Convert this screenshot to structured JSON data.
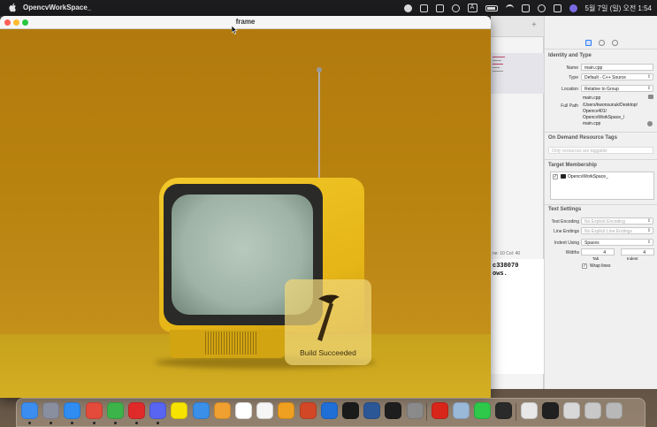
{
  "menubar": {
    "app_name": "OpencvWorkSpace_",
    "status_A": "A",
    "clock": "5월 7일 (일) 오전 1:54"
  },
  "frame_window": {
    "title": "frame",
    "hud": {
      "label": "Build Succeeded",
      "icon": "hammer-icon"
    }
  },
  "xcode": {
    "editor_status": "ne: 10  Col: 40",
    "console_lines": [
      "c338070",
      "ows."
    ],
    "inspector": {
      "identity_title": "Identity and Type",
      "name_label": "Name",
      "name_value": "main.cpp",
      "type_label": "Type",
      "type_value": "Default - C++ Source",
      "location_label": "Location",
      "location_value": "Relative to Group",
      "location_file": "main.cpp",
      "fullpath_label": "Full Path",
      "fullpath_value": [
        "/Users/kwonsunuk/Desktop/",
        "Opencv401/",
        "OpencvWorkSpace_/",
        "main.cpp"
      ],
      "odr_title": "On Demand Resource Tags",
      "odr_placeholder": "Only resources are taggable",
      "target_title": "Target Membership",
      "target_item": "OpencvWorkSpace_",
      "text_settings_title": "Text Settings",
      "text_encoding_label": "Text Encoding",
      "text_encoding_value": "No Explicit Encoding",
      "line_endings_label": "Line Endings",
      "line_endings_value": "No Explicit Line Endings",
      "indent_using_label": "Indent Using",
      "indent_using_value": "Spaces",
      "widths_label": "Widths",
      "tab_value": "4",
      "indent_value": "4",
      "tab_label": "Tab",
      "indent_label": "Indent",
      "wrap_lines_label": "Wrap lines",
      "wrap_lines_checked": true
    }
  },
  "dock": {
    "items": [
      {
        "name": "finder-icon",
        "color": "#3b8ef0"
      },
      {
        "name": "launchpad-icon",
        "color": "#8a8fa0"
      },
      {
        "name": "safari-icon",
        "color": "#2f8cf0"
      },
      {
        "name": "chrome-icon",
        "color": "#e44b3b"
      },
      {
        "name": "bt-app-icon",
        "color": "#3cb44a"
      },
      {
        "name": "youtube-music-icon",
        "color": "#e02a2a"
      },
      {
        "name": "discord-icon",
        "color": "#5865f2"
      },
      {
        "name": "kakaotalk-icon",
        "color": "#f7e300"
      },
      {
        "name": "mail-icon",
        "color": "#3a8fe8"
      },
      {
        "name": "photos-icon",
        "color": "#f0a030"
      },
      {
        "name": "calendar-icon",
        "color": "#ffffff"
      },
      {
        "name": "notes-icon",
        "color": "#f5f5f5"
      },
      {
        "name": "pages-icon",
        "color": "#f0a020"
      },
      {
        "name": "powerpoint-icon",
        "color": "#d24726"
      },
      {
        "name": "xcode-icon",
        "color": "#1f6fd6"
      },
      {
        "name": "intellij-icon",
        "color": "#1a1a1a"
      },
      {
        "name": "word-icon",
        "color": "#2b5797"
      },
      {
        "name": "terminal-icon",
        "color": "#1e1e1e"
      },
      {
        "name": "system-settings-icon",
        "color": "#8a8a8a"
      },
      {
        "name": "acrobat-icon",
        "color": "#d8261b"
      },
      {
        "name": "preview-icon",
        "color": "#9ab8d8"
      },
      {
        "name": "facetime-icon",
        "color": "#2ec84a"
      },
      {
        "name": "terminal-window-icon",
        "color": "#2a2a2a"
      },
      {
        "name": "document-icon",
        "color": "#e8e8e8"
      },
      {
        "name": "terminal-window-2-icon",
        "color": "#202020"
      },
      {
        "name": "window-thumbnail-icon",
        "color": "#d8d8d8"
      },
      {
        "name": "downloads-icon",
        "color": "#c8c8c8"
      },
      {
        "name": "trash-icon",
        "color": "#b8b8b8"
      }
    ]
  }
}
